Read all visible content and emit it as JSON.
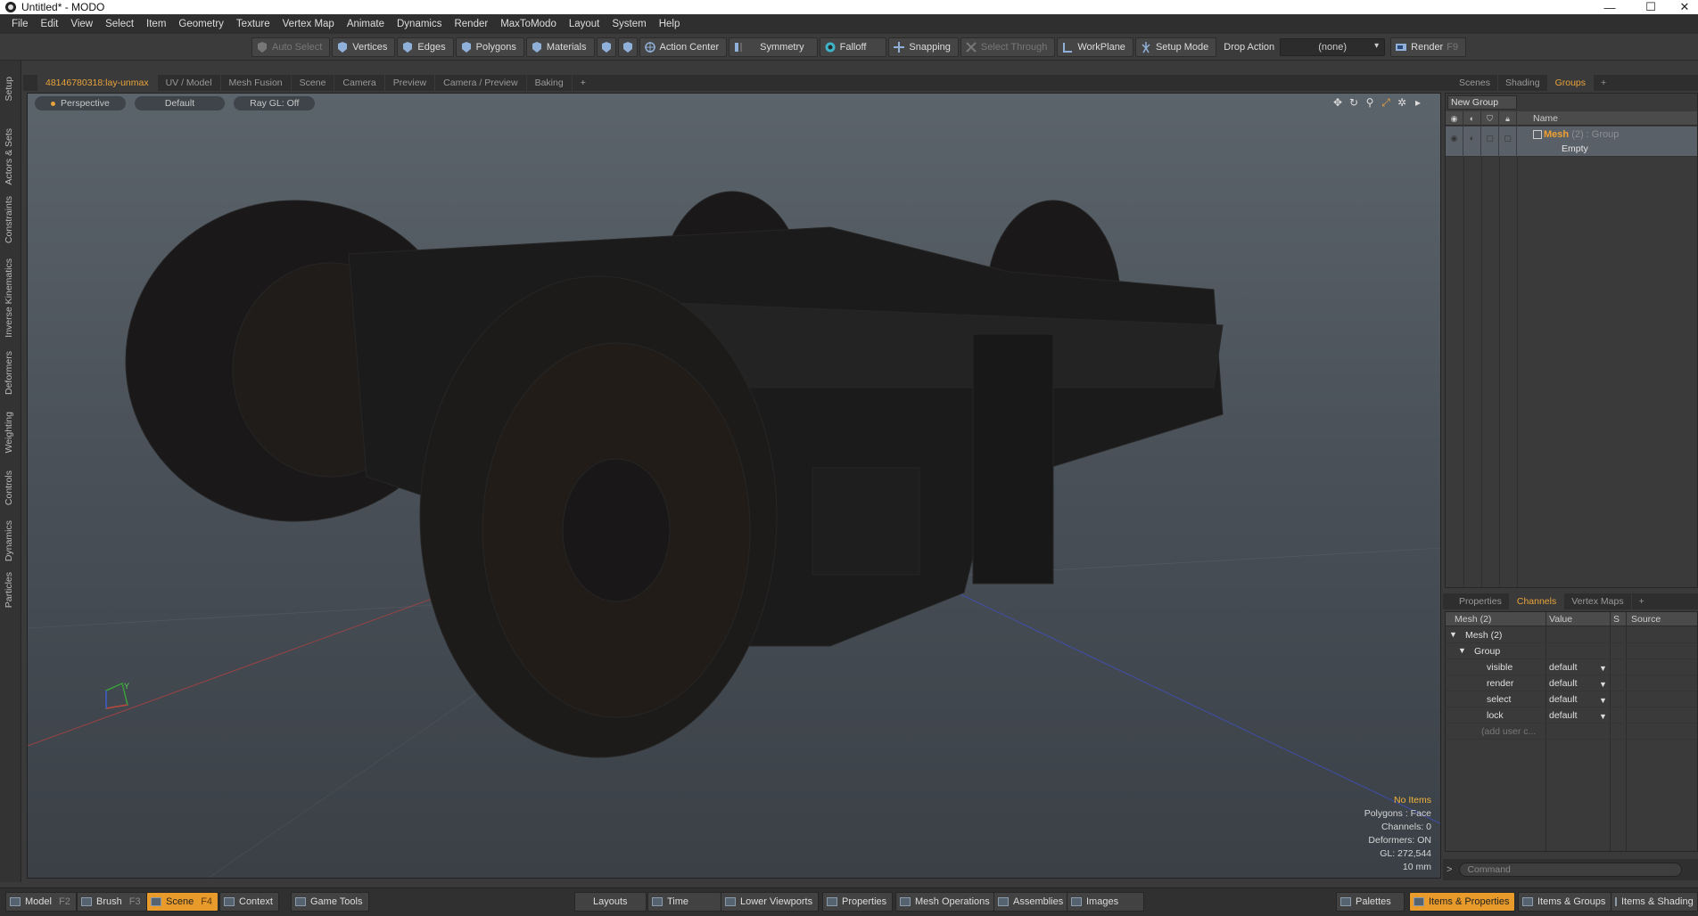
{
  "window": {
    "title": "Untitled* - MODO",
    "controls": [
      "minimize-icon",
      "maximize-icon",
      "close-icon"
    ]
  },
  "menu": [
    "File",
    "Edit",
    "View",
    "Select",
    "Item",
    "Geometry",
    "Texture",
    "Vertex Map",
    "Animate",
    "Dynamics",
    "Render",
    "MaxToModo",
    "Layout",
    "System",
    "Help"
  ],
  "toolbar": {
    "auto_select": "Auto Select",
    "vertices": "Vertices",
    "edges": "Edges",
    "polygons": "Polygons",
    "materials": "Materials",
    "action_center": "Action Center",
    "symmetry": "Symmetry",
    "falloff": "Falloff",
    "snapping": "Snapping",
    "select_through": "Select Through",
    "workplane": "WorkPlane",
    "setup_mode": "Setup Mode",
    "drop_action_label": "Drop Action",
    "drop_action_value": "(none)",
    "render": "Render",
    "render_key": "F9"
  },
  "left_tabs": [
    "Setup",
    "Actors & Sets",
    "Constraints",
    "Inverse Kinematics",
    "Deformers",
    "Weighting",
    "Controls",
    "Dynamics",
    "Particles"
  ],
  "viewport_tabs": [
    "48146780318:lay-unmax",
    "UV / Model",
    "Mesh Fusion",
    "Scene",
    "Camera",
    "Preview",
    "Camera / Preview",
    "Baking",
    "+"
  ],
  "viewport": {
    "view": "Perspective",
    "shading": "Default",
    "raygl": "Ray GL: Off",
    "stats": {
      "items": "No Items",
      "polygons": "Polygons : Face",
      "channels": "Channels: 0",
      "deformers": "Deformers: ON",
      "gl": "GL: 272,544",
      "scale": "10 mm"
    },
    "axis_label": "Y"
  },
  "right_top_tabs": [
    "Scenes",
    "Shading",
    "Groups",
    "+"
  ],
  "groups": {
    "new_group": "New Group",
    "column_name": "Name",
    "row": {
      "name": "Mesh",
      "meta": "(2) : Group",
      "status": "Empty"
    }
  },
  "right_mid_tabs": [
    "Properties",
    "Channels",
    "Vertex Maps",
    "+"
  ],
  "channels": {
    "headers": {
      "item": "Mesh (2)",
      "value": "Value",
      "s": "S",
      "source": "Source"
    },
    "tree_mesh": "Mesh (2)",
    "tree_group": "Group",
    "rows": [
      {
        "name": "visible",
        "value": "default"
      },
      {
        "name": "render",
        "value": "default"
      },
      {
        "name": "select",
        "value": "default"
      },
      {
        "name": "lock",
        "value": "default"
      }
    ],
    "add_user": "(add user c..."
  },
  "command": {
    "prompt": ">",
    "placeholder": "Command"
  },
  "bottom": {
    "model": "Model",
    "model_key": "F2",
    "brush": "Brush",
    "brush_key": "F3",
    "scene": "Scene",
    "scene_key": "F4",
    "context": "Context",
    "game_tools": "Game Tools",
    "layouts": "Layouts",
    "time": "Time",
    "lower_viewports": "Lower Viewports",
    "properties": "Properties",
    "mesh_operations": "Mesh Operations",
    "assemblies": "Assemblies",
    "images": "Images",
    "palettes": "Palettes",
    "items_properties": "Items & Properties",
    "items_groups": "Items & Groups",
    "items_shading": "Items & Shading"
  },
  "colors": {
    "accent": "#e8a33a",
    "active_tab": "#e89a2a",
    "viewport_top": "#5b636b",
    "viewport_bottom": "#3a4046"
  }
}
